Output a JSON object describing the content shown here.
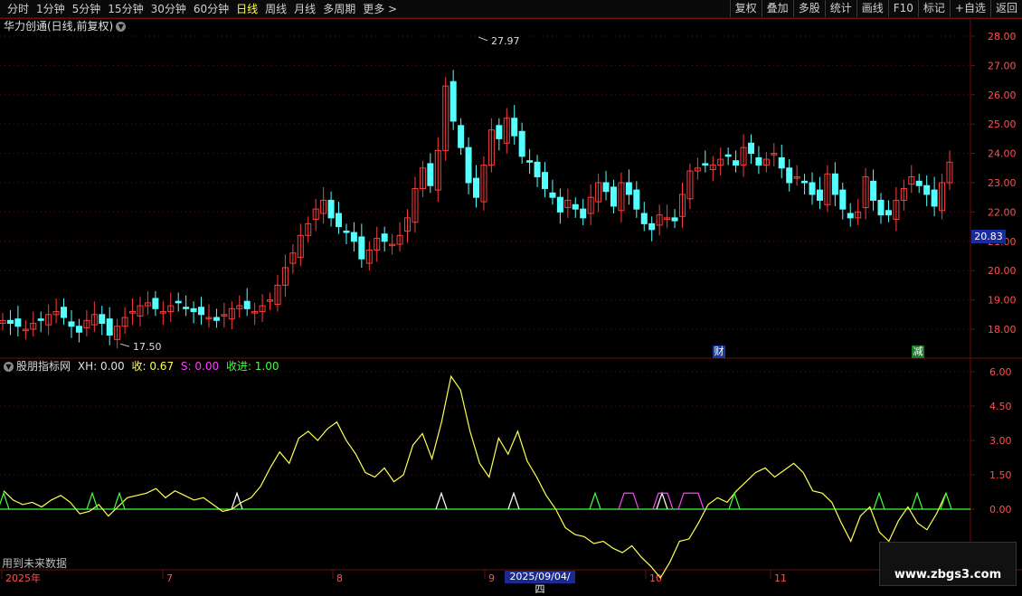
{
  "toolbar": {
    "periods": [
      "分时",
      "1分钟",
      "5分钟",
      "15分钟",
      "30分钟",
      "60分钟",
      "日线",
      "周线",
      "月线",
      "多周期",
      "更多 >"
    ],
    "active_index": 6,
    "right_buttons": [
      "复权",
      "叠加",
      "多股",
      "统计",
      "画线",
      "F10",
      "标记",
      "+自选",
      "返回"
    ]
  },
  "main_panel": {
    "title": "华力创通(日线,前复权)",
    "title_icon": "chevron-down-icon",
    "y_ticks": [
      "28.00",
      "27.00",
      "26.00",
      "25.00",
      "24.00",
      "23.00",
      "22.00",
      "21.00",
      "20.00",
      "19.00",
      "18.00"
    ],
    "current_price": "20.83",
    "high_label": "27.97",
    "low_label": "17.50",
    "badge_cai": "财",
    "badge_jian": "减",
    "colors": {
      "up": "#ff3c3c",
      "down": "#54ffff",
      "grid": "#6a1010"
    }
  },
  "indicator_panel": {
    "name": "股朋指标网",
    "xh_label": "XH: 0.00",
    "shou_label": "收: 0.67",
    "s_label": "S: 0.00",
    "shoujin_label": "收进: 1.00",
    "y_ticks": [
      "6.00",
      "4.50",
      "3.00",
      "1.50",
      "0.00"
    ],
    "colors": {
      "line": "#ffff55",
      "zero": "#40ff40",
      "s": "#ff40ff"
    }
  },
  "x_axis": {
    "labels": [
      "2025年",
      "7",
      "8",
      "9",
      "10",
      "11"
    ],
    "cursor_date": "2025/09/04/四"
  },
  "footer_note": "用到未来数据",
  "watermark": {
    "url": "www.zbgs3.com"
  }
}
